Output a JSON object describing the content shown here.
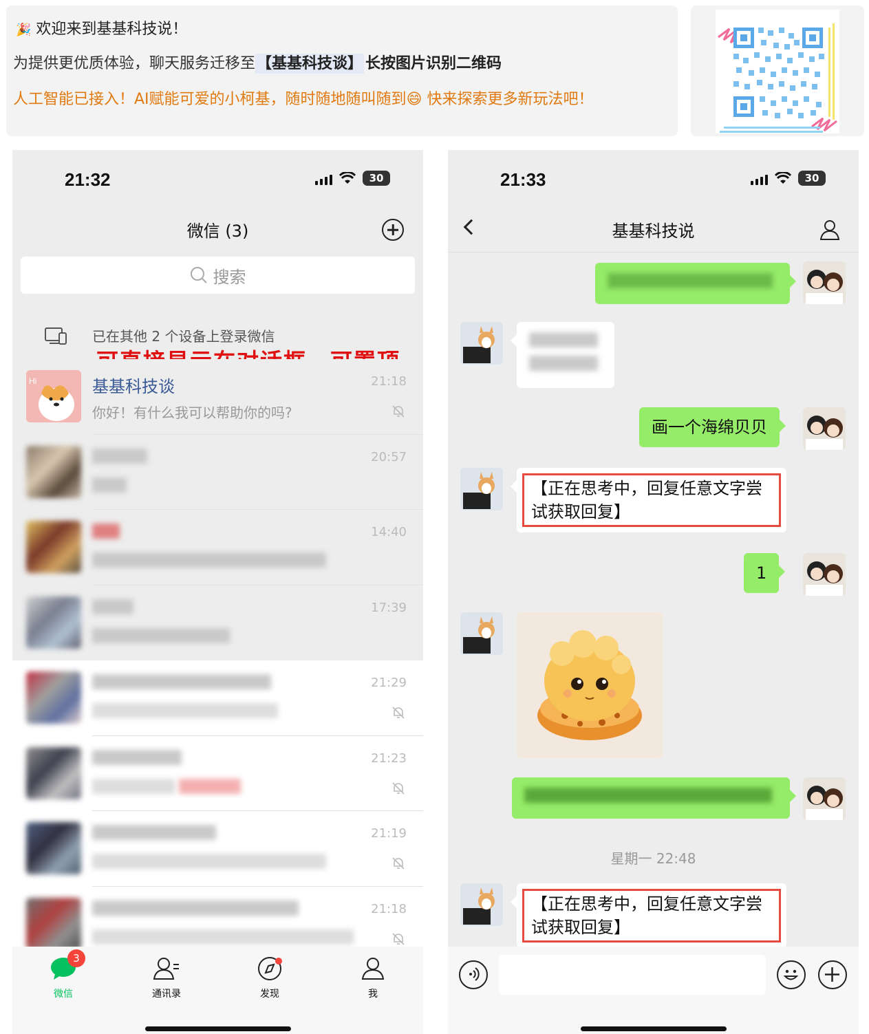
{
  "banner": {
    "line1": "欢迎来到基基科技说！",
    "line2_pre": "为提供更优质体验，聊天服务迁移至",
    "line2_bold": "【基基科技谈】",
    "line2_post": "长按图片识别二维码",
    "line3": "人工智能已接入！AI赋能可爱的小柯基，随时随地随叫随到😄 快来探索更多新玩法吧！"
  },
  "left": {
    "time": "21:32",
    "battery": "30",
    "title": "微信 (3)",
    "search_placeholder": "搜索",
    "devices_text": "已在其他 2 个设备上登录微信",
    "overlay_text": "可直接显示在对话框，可置顶",
    "chats": [
      {
        "name": "基基科技谈",
        "preview": "你好！有什么我可以帮助你的吗?",
        "time": "21:18",
        "muted": true
      },
      {
        "name": "",
        "preview": "",
        "time": "20:57",
        "muted": false
      },
      {
        "name": "",
        "preview": "",
        "time": "14:40",
        "muted": false
      },
      {
        "name": "",
        "preview": "",
        "time": "17:39",
        "muted": false
      },
      {
        "name": "",
        "preview": "",
        "time": "21:29",
        "muted": true
      },
      {
        "name": "",
        "preview": "",
        "time": "21:23",
        "muted": true
      },
      {
        "name": "",
        "preview": "",
        "time": "21:19",
        "muted": true
      },
      {
        "name": "",
        "preview": "",
        "time": "21:18",
        "muted": true
      }
    ],
    "tabs": [
      {
        "label": "微信",
        "badge": "3",
        "icon": "chat-icon"
      },
      {
        "label": "通讯录",
        "icon": "contacts-icon"
      },
      {
        "label": "发现",
        "icon": "compass-icon"
      },
      {
        "label": "我",
        "icon": "profile-icon"
      }
    ]
  },
  "right": {
    "time": "21:33",
    "battery": "30",
    "title": "基基科技说",
    "messages": {
      "m3": "画一个海绵贝贝",
      "m4": "【正在思考中，回复任意文字尝试获取回复】",
      "m5": "1",
      "timestamp": "星期一 22:48",
      "m8": "【正在思考中，回复任意文字尝试获取回复】"
    }
  }
}
